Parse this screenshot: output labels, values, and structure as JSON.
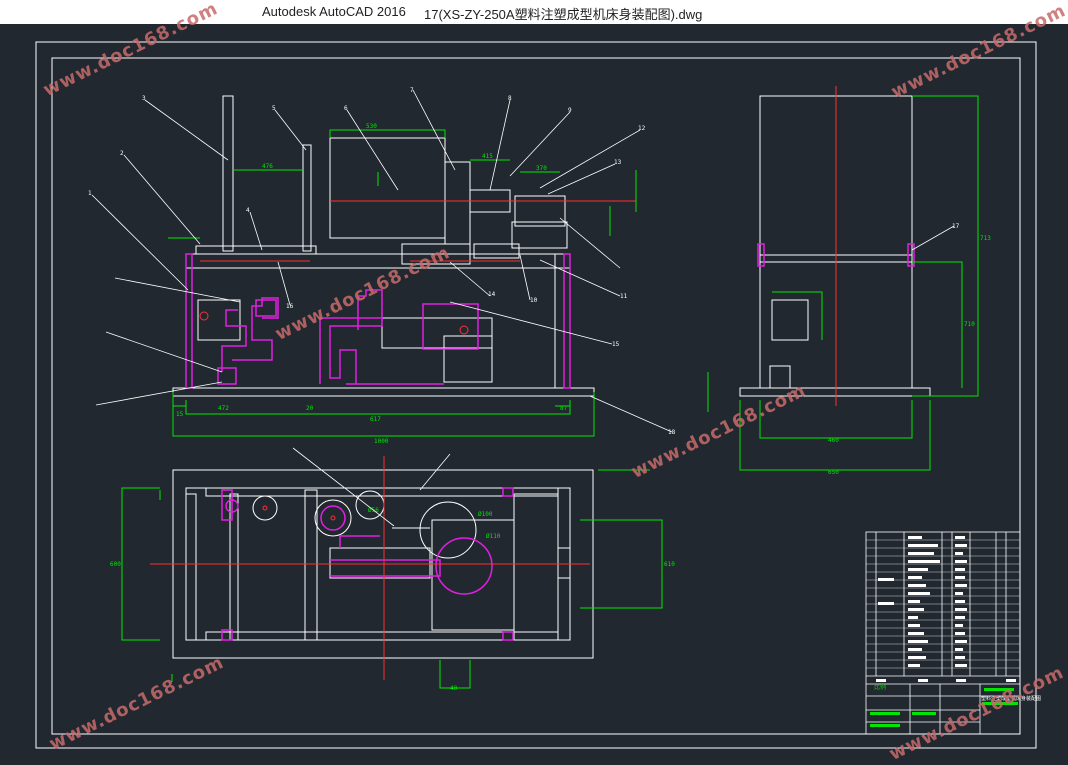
{
  "app": {
    "name": "Autodesk AutoCAD 2016",
    "document": "17(XS-ZY-250A塑料注塑成型机床身装配图).dwg"
  },
  "watermark": {
    "text": "www.doc168.com",
    "color": "#c86b6b"
  },
  "drawing": {
    "colors": {
      "background": "#212830",
      "lines": "#ffffff",
      "dimensions": "#00e600",
      "centerline": "#ff3030",
      "parts": "#e020e0"
    },
    "front_view_dims": {
      "d1": "476",
      "d2": "530",
      "d3": "415",
      "d4": "370",
      "d5": "472",
      "d6": "617",
      "d7": "1000",
      "d8": "15",
      "d9": "20",
      "d10": "87"
    },
    "plan_view_dims": {
      "d1": "Ø56",
      "d2": "Ø100",
      "d3": "Ø110",
      "d4": "600",
      "d5": "610",
      "d6": "40"
    },
    "side_view_dims": {
      "d1": "713",
      "d2": "710",
      "d3": "460",
      "d4": "650"
    },
    "part_labels": [
      "1",
      "2",
      "3",
      "4",
      "5",
      "6",
      "7",
      "8",
      "9",
      "10",
      "11",
      "12",
      "13",
      "14",
      "15",
      "16",
      "17",
      "18"
    ],
    "title_block": {
      "scale_label": "比例",
      "name": "塑料注塑成型机床身装配图"
    }
  }
}
